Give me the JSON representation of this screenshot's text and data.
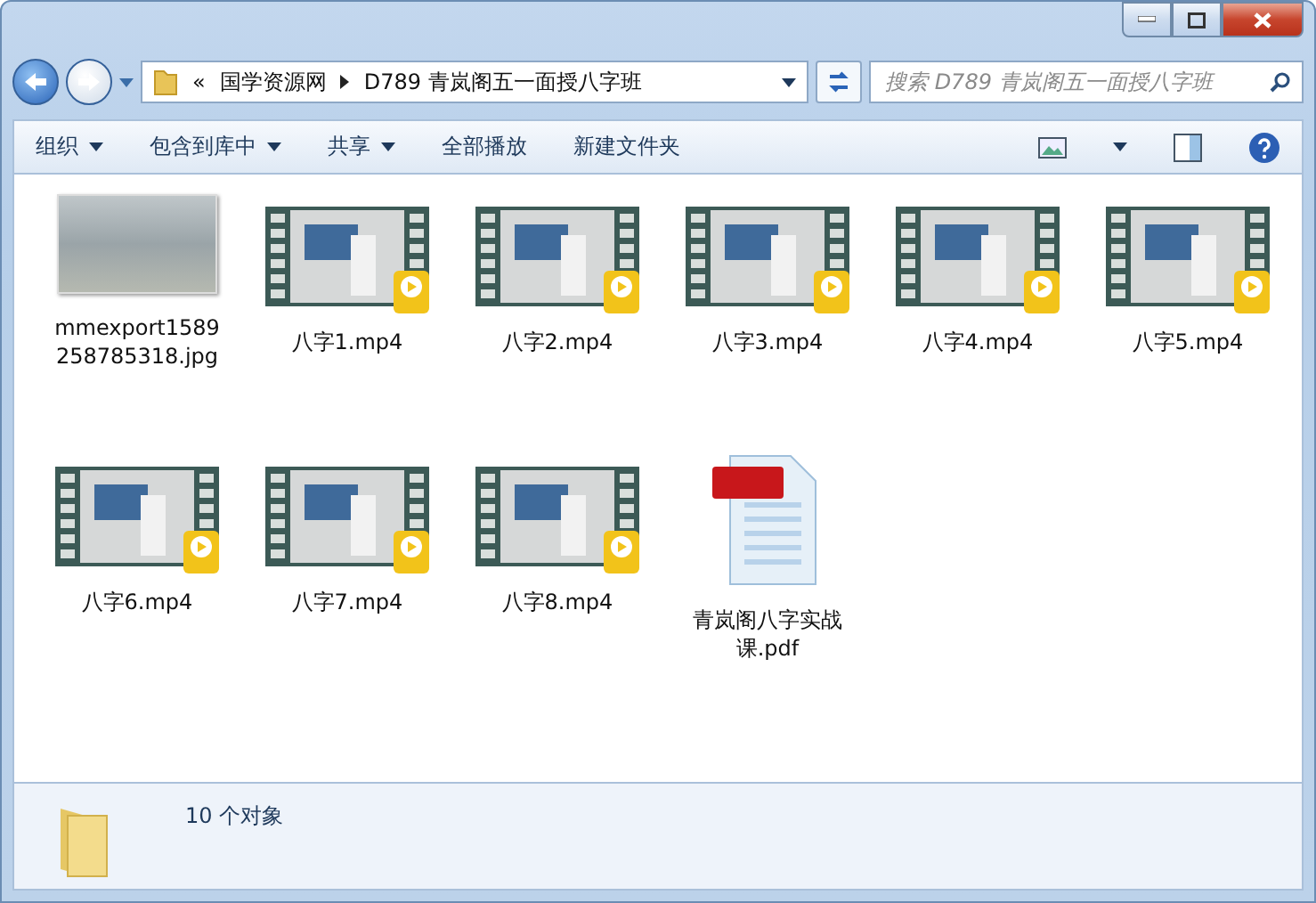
{
  "address": {
    "overflow": "«",
    "crumbs": [
      "国学资源网",
      "D789 青岚阁五一面授八字班"
    ]
  },
  "search": {
    "placeholder": "搜索 D789 青岚阁五一面授八字班"
  },
  "toolbar": [
    {
      "label": "组织",
      "menu": true
    },
    {
      "label": "包含到库中",
      "menu": true
    },
    {
      "label": "共享",
      "menu": true
    },
    {
      "label": "全部播放",
      "menu": false
    },
    {
      "label": "新建文件夹",
      "menu": false
    }
  ],
  "files": [
    {
      "name": "mmexport1589258785318.jpg",
      "kind": "image"
    },
    {
      "name": "八字1.mp4",
      "kind": "video"
    },
    {
      "name": "八字2.mp4",
      "kind": "video"
    },
    {
      "name": "八字3.mp4",
      "kind": "video"
    },
    {
      "name": "八字4.mp4",
      "kind": "video"
    },
    {
      "name": "八字5.mp4",
      "kind": "video"
    },
    {
      "name": "八字6.mp4",
      "kind": "video"
    },
    {
      "name": "八字7.mp4",
      "kind": "video"
    },
    {
      "name": "八字8.mp4",
      "kind": "video"
    },
    {
      "name": "青岚阁八字实战课.pdf",
      "kind": "pdf"
    }
  ],
  "status_bar": {
    "count": "10 个对象"
  }
}
